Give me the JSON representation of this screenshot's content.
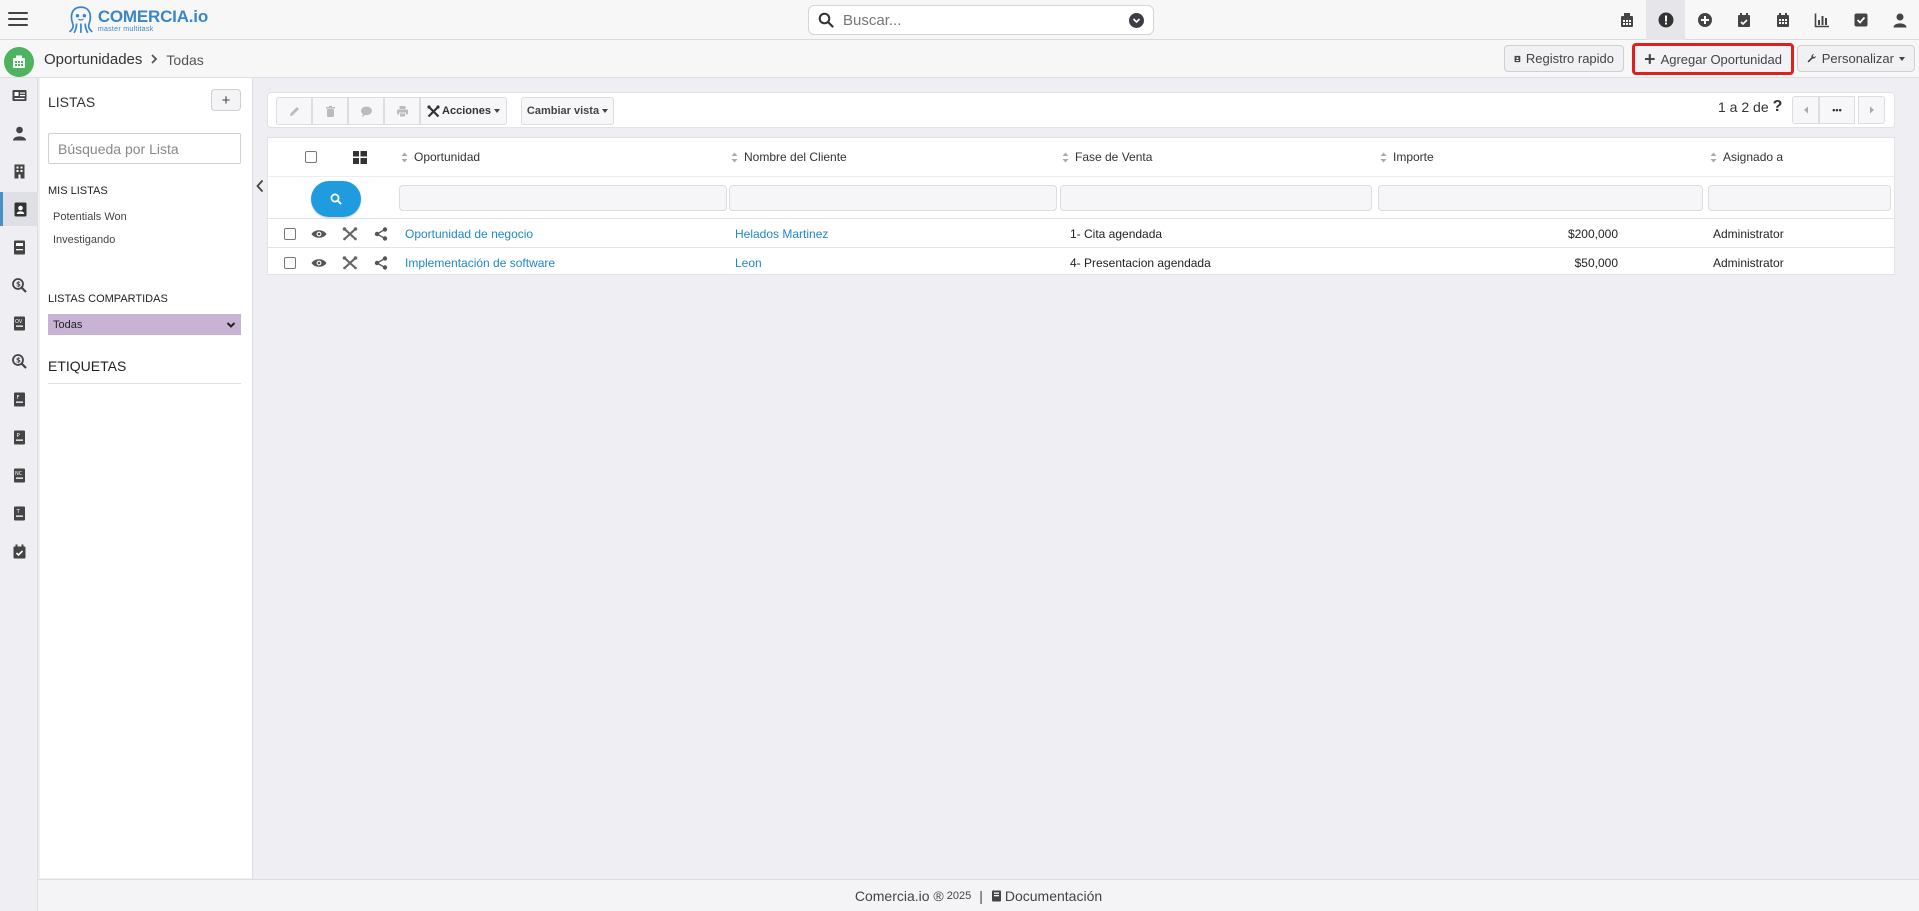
{
  "brand": {
    "name": "COMERCIA.io",
    "tagline": "master multitask"
  },
  "search": {
    "placeholder": "Buscar..."
  },
  "top_icons": [
    "calculator-icon",
    "alert-icon",
    "plus-circle-icon",
    "calendar-check-icon",
    "calendar-icon",
    "chart-icon",
    "checkbox-icon",
    "user-icon"
  ],
  "breadcrumb": {
    "module": "Oportunidades",
    "current": "Todas"
  },
  "header_buttons": {
    "registro": "Registro rapido",
    "agregar": "Agregar Oportunidad",
    "personalizar": "Personalizar"
  },
  "rail_icons": [
    "id-card-icon",
    "person-icon",
    "building-icon",
    "contact-icon",
    "ledger-icon",
    "search-dollar-icon",
    "quote-icon",
    "search-dollar-icon",
    "invoice-icon",
    "purchase-order-icon",
    "sales-order-icon",
    "template-icon",
    "calendar-check-icon"
  ],
  "lists": {
    "title": "LISTAS",
    "add": "+",
    "search_placeholder": "Búsqueda por Lista",
    "mine_title": "MIS LISTAS",
    "mine": [
      "Potentials Won",
      "Investigando"
    ],
    "shared_title": "LISTAS COMPARTIDAS",
    "shared_selected": "Todas",
    "tags_title": "ETIQUETAS"
  },
  "toolbar": {
    "acciones": "Acciones",
    "cambiar_vista": "Cambiar vista"
  },
  "pager": {
    "text": "1 a 2  de",
    "more": "•••"
  },
  "table": {
    "headers": [
      "Oportunidad",
      "Nombre del Cliente",
      "Fase de Venta",
      "Importe",
      "Asignado a"
    ],
    "rows": [
      {
        "oportunidad": "Oportunidad de negocio",
        "cliente": "Helados Martinez",
        "fase": "1- Cita agendada",
        "importe": "$200,000",
        "asignado": "Administrator"
      },
      {
        "oportunidad": "Implementación de software",
        "cliente": "Leon",
        "fase": "4- Presentacion agendada",
        "importe": "$50,000",
        "asignado": "Administrator"
      }
    ]
  },
  "footer": {
    "copy": "Comercia.io ®",
    "year": "2025",
    "doc": "Documentación"
  },
  "colors": {
    "accent": "#1f9be0",
    "link": "#1f87cc",
    "module": "#4db35f",
    "highlight": "#e02020",
    "shared_select": "#c9b3d4"
  }
}
